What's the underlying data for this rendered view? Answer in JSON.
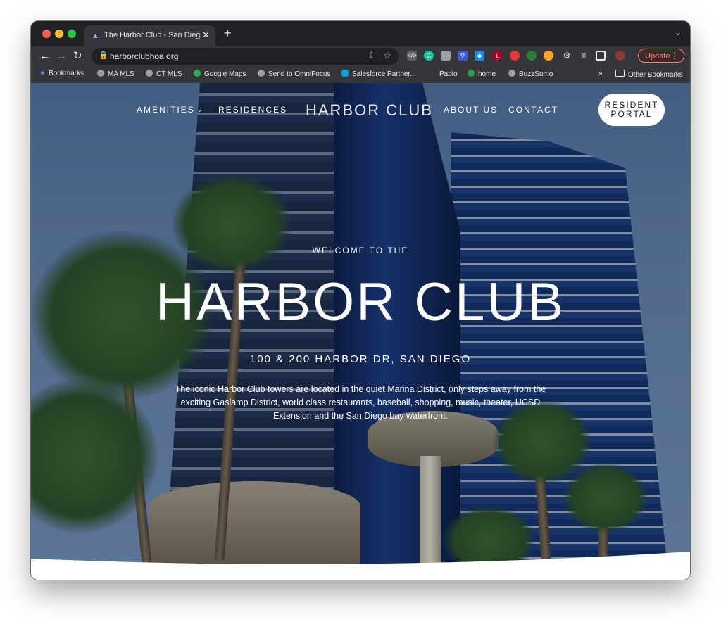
{
  "browser": {
    "tab_title": "The Harbor Club - San Diego, C",
    "url": "harborclubhoa.org",
    "update_label": "Update",
    "bookmarks": [
      "Bookmarks",
      "MA MLS",
      "CT MLS",
      "Google Maps",
      "Send to OmniFocus",
      "Salesforce Partner...",
      "Pablo",
      "home",
      "BuzzSumo"
    ],
    "other_bookmarks": "Other Bookmarks"
  },
  "site": {
    "logo": "HARBOR CLUB",
    "nav": {
      "amenities": "AMENITIES",
      "residences": "RESIDENCES",
      "about": "ABOUT US",
      "contact": "CONTACT"
    },
    "portal_line1": "RESIDENT",
    "portal_line2": "PORTAL"
  },
  "hero": {
    "kicker": "WELCOME TO THE",
    "title": "HARBOR CLUB",
    "address": "100 & 200 HARBOR DR, SAN DIEGO",
    "description": "The iconic Harbor Club towers are located in the quiet Marina District, only steps away from the exciting Gaslamp District, world class restaurants, baseball, shopping, music, theater, UCSD Extension and the San Diego bay waterfront."
  },
  "colors": {
    "accent_update": "#f28b82",
    "chrome_dark": "#202124",
    "chrome_toolbar": "#35363a"
  }
}
